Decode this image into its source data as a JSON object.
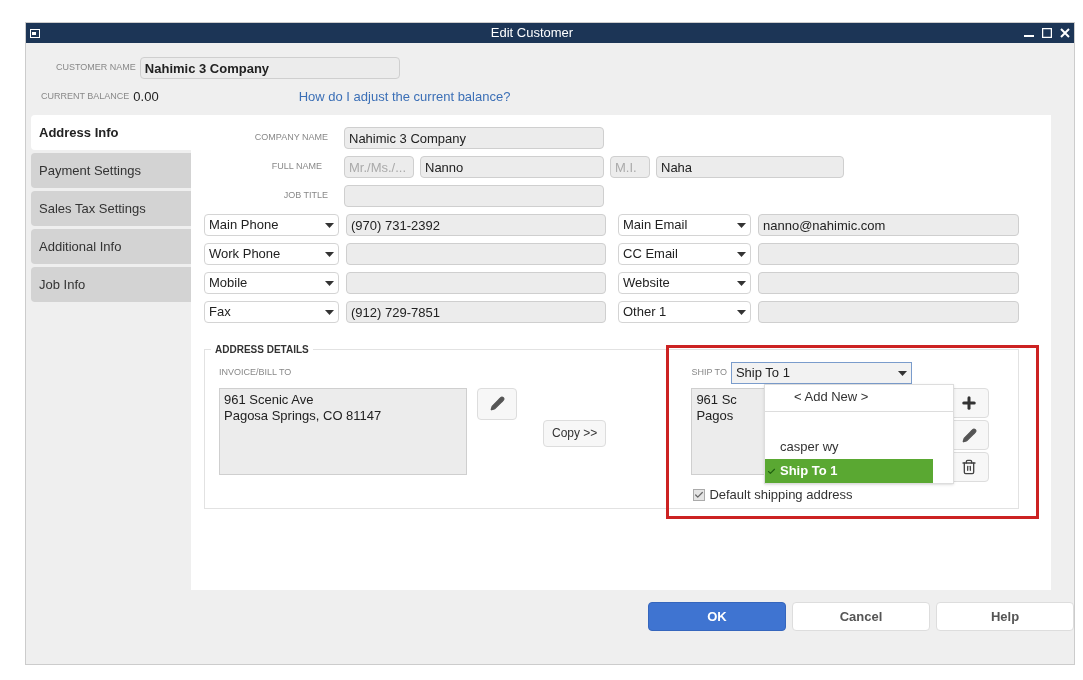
{
  "window": {
    "title": "Edit Customer"
  },
  "customer_name": {
    "label": "CUSTOMER NAME",
    "value": "Nahimic 3 Company"
  },
  "balance": {
    "label": "CURRENT BALANCE",
    "value": "0.00",
    "help_link": "How do I adjust the current balance?"
  },
  "tabs": [
    {
      "label": "Address Info",
      "selected": true
    },
    {
      "label": "Payment Settings",
      "selected": false
    },
    {
      "label": "Sales Tax Settings",
      "selected": false
    },
    {
      "label": "Additional Info",
      "selected": false
    },
    {
      "label": "Job Info",
      "selected": false
    }
  ],
  "form": {
    "company_name": {
      "label": "COMPANY NAME",
      "value": "Nahimic 3 Company"
    },
    "full_name": {
      "label": "FULL NAME",
      "title_placeholder": "Mr./Ms./...",
      "first": "Nanno",
      "mi_placeholder": "M.I.",
      "last": "Naha"
    },
    "job_title": {
      "label": "JOB TITLE"
    },
    "contact_rows": [
      {
        "left_type": "Main Phone",
        "left_value": "(970) 731-2392",
        "right_type": "Main Email",
        "right_value": "nanno@nahimic.com"
      },
      {
        "left_type": "Work Phone",
        "right_type": "CC Email"
      },
      {
        "left_type": "Mobile",
        "right_type": "Website"
      },
      {
        "left_type": "Fax",
        "left_value": "(912) 729-7851",
        "right_type": "Other 1"
      }
    ]
  },
  "address": {
    "title": "ADDRESS DETAILS",
    "bill_to": {
      "label": "INVOICE/BILL TO",
      "lines": [
        "961 Scenic Ave",
        "Pagosa Springs, CO 81147"
      ]
    },
    "copy_button": "Copy >>",
    "ship_to": {
      "label": "SHIP TO",
      "value": "Ship To 1",
      "lines": [
        "961 Sc",
        "Pagos"
      ],
      "dropdown": [
        {
          "label": "< Add New >",
          "kind": "add",
          "selected": false
        },
        {
          "kind": "separator"
        },
        {
          "label": "casper wy",
          "kind": "option",
          "selected": false
        },
        {
          "label": "Ship To 1",
          "kind": "option",
          "selected": true
        }
      ],
      "default": {
        "label": "Default shipping address",
        "checked": true
      }
    }
  },
  "buttons": [
    {
      "label": "OK",
      "kind": "primary"
    },
    {
      "label": "Cancel",
      "kind": "normal"
    },
    {
      "label": "Help",
      "kind": "normal"
    }
  ]
}
